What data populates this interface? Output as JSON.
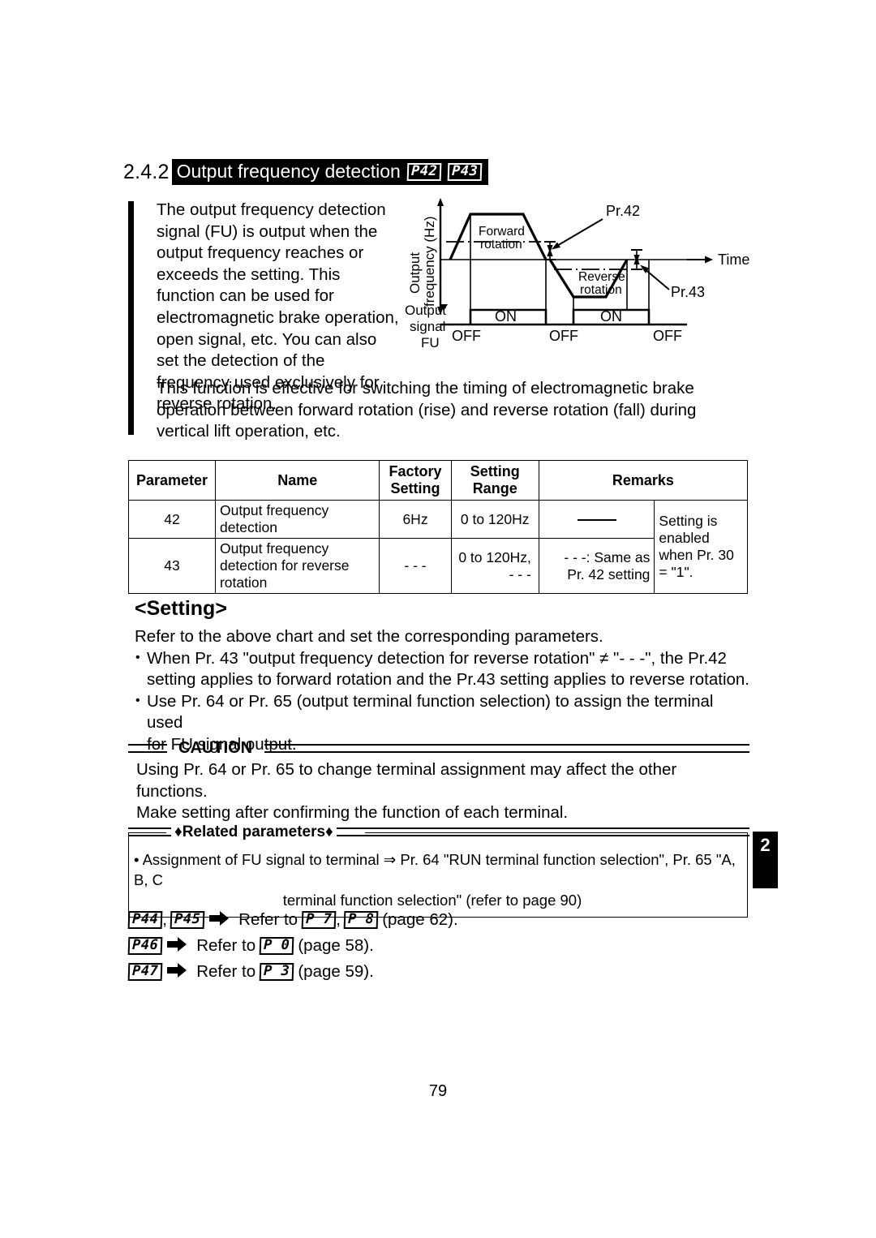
{
  "heading": {
    "section_number": "2.4.2",
    "title": "Output frequency detection",
    "param_chips": [
      "P42",
      "P43"
    ]
  },
  "intro": {
    "narrow_text": "The output frequency detection signal (FU) is output when the output frequency reaches or exceeds the setting. This function can be used for electromagnetic brake operation, open signal, etc. You can also set the detection of the frequency used exclusively for reverse rotation.",
    "wide_text": "This function is effective for switching the timing of electromagnetic brake operation between forward rotation (rise) and reverse rotation (fall) during vertical lift operation, etc."
  },
  "diagram": {
    "y_axis_label_line1": "Output",
    "y_axis_label_line2": "frequency (Hz)",
    "signal_label_line1": "Output",
    "signal_label_line2": "signal",
    "signal_label_line3": "FU",
    "forward_label_line1": "Forward",
    "forward_label_line2": "rotation",
    "reverse_label_line1": "Reverse",
    "reverse_label_line2": "rotation",
    "pr42_label": "Pr.42",
    "pr43_label": "Pr.43",
    "time_label": "Time",
    "states": [
      "OFF",
      "ON",
      "OFF",
      "ON",
      "OFF"
    ]
  },
  "table": {
    "headers": {
      "parameter": "Parameter",
      "name": "Name",
      "factory_setting_line1": "Factory",
      "factory_setting_line2": "Setting",
      "setting_range_line1": "Setting",
      "setting_range_line2": "Range",
      "remarks": "Remarks"
    },
    "rows": [
      {
        "parameter": "42",
        "name": "Output frequency detection",
        "factory_setting": "6Hz",
        "setting_range": "0 to 120Hz",
        "remark_a": "",
        "remark_b": ""
      },
      {
        "parameter": "43",
        "name": "Output frequency detection for reverse rotation",
        "factory_setting": "- - -",
        "setting_range_line1": "0 to 120Hz,",
        "setting_range_line2": "- - -",
        "remark_a_line1": "- - -: Same as",
        "remark_a_line2": "Pr. 42 setting"
      }
    ],
    "remark_merged": "Setting is enabled when Pr. 30 = \"1\"."
  },
  "setting": {
    "heading": "<Setting>",
    "lead": "Refer to the above chart and set the corresponding parameters.",
    "bullets": [
      {
        "line1": "When Pr. 43 \"output frequency detection for reverse rotation\" ≠ \"- - -\", the Pr.42",
        "line2": "setting applies to forward rotation and the Pr.43 setting applies to reverse rotation."
      },
      {
        "line1": "Use Pr. 64 or Pr. 65 (output terminal function selection) to assign the terminal used",
        "line2": "for FU signal output."
      }
    ]
  },
  "caution": {
    "label": "CAUTION",
    "line1": "Using Pr. 64 or Pr. 65 to change terminal assignment may affect the other functions.",
    "line2": "Make setting after confirming the function of each terminal."
  },
  "related": {
    "title": "♦Related parameters♦",
    "line1": "• Assignment of FU signal to terminal ⇒ Pr. 64 \"RUN terminal function selection\", Pr. 65 \"A, B, C",
    "line2": "terminal function selection\" (refer to page 90)"
  },
  "chapter_tab": "2",
  "references": [
    {
      "chips": [
        "P44",
        "P45"
      ],
      "refer_text": "Refer to",
      "target_chips": [
        "P  7",
        "P  8"
      ],
      "page_text": "(page 62)."
    },
    {
      "chips": [
        "P46"
      ],
      "refer_text": "Refer to",
      "target_chips": [
        "P  0"
      ],
      "page_text": "(page 58)."
    },
    {
      "chips": [
        "P47"
      ],
      "refer_text": "Refer to",
      "target_chips": [
        "P  3"
      ],
      "page_text": "(page 59)."
    }
  ],
  "page_number": "79",
  "colors": {
    "ink": "#000000",
    "paper": "#ffffff"
  }
}
